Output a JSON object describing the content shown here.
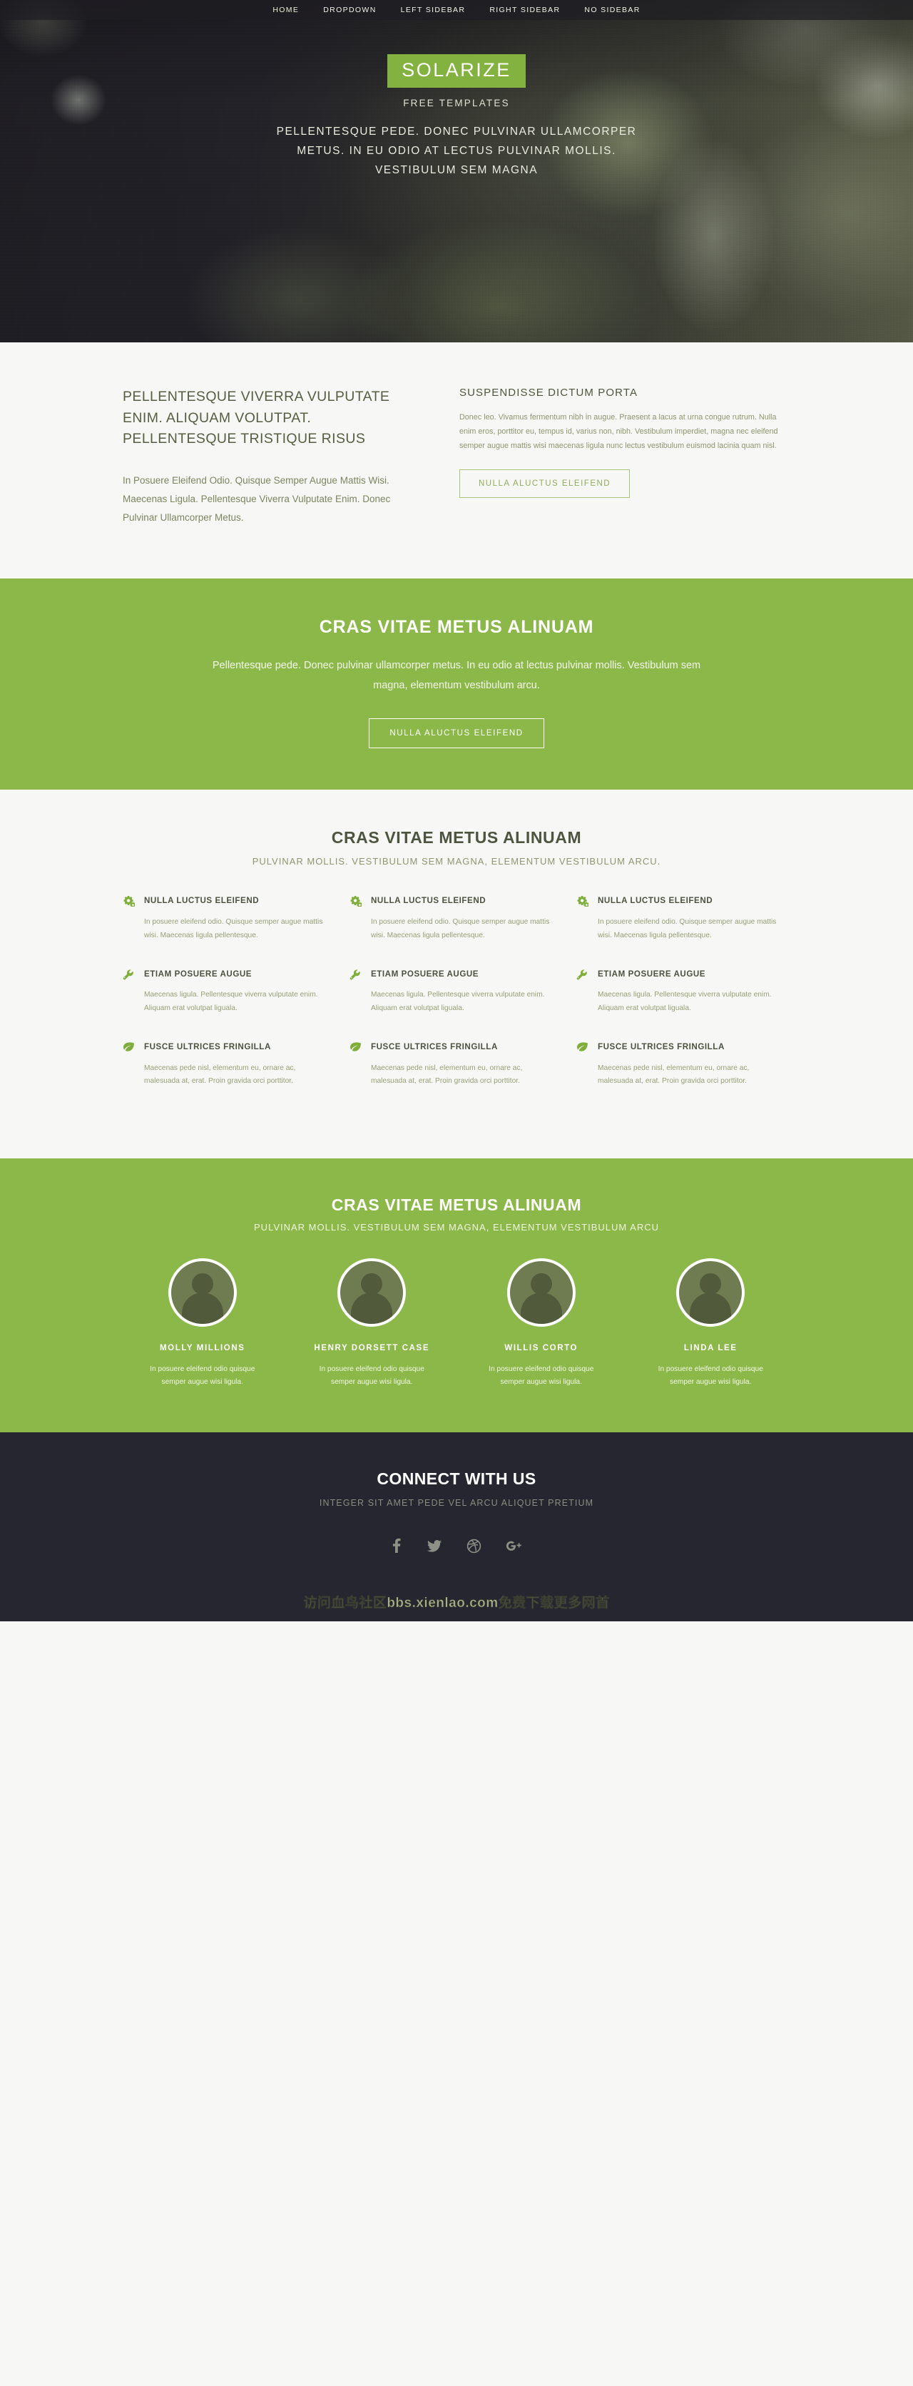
{
  "brand": {
    "accent_green": "#8cb84a",
    "dark": "#262630",
    "logo": "SOLARIZE"
  },
  "nav": {
    "items": [
      {
        "label": "HOME",
        "name": "nav-home"
      },
      {
        "label": "DROPDOWN",
        "name": "nav-dropdown"
      },
      {
        "label": "LEFT SIDEBAR",
        "name": "nav-left-sidebar"
      },
      {
        "label": "RIGHT SIDEBAR",
        "name": "nav-right-sidebar"
      },
      {
        "label": "NO SIDEBAR",
        "name": "nav-no-sidebar"
      }
    ]
  },
  "hero": {
    "logo": "SOLARIZE",
    "subtitle": "FREE TEMPLATES",
    "tagline_line1": "PELLENTESQUE PEDE. DONEC PULVINAR ULLAMCORPER",
    "tagline_line2": "METUS. IN EU ODIO AT LECTUS PULVINAR MOLLIS.",
    "tagline_line3": "VESTIBULUM SEM MAGNA"
  },
  "intro": {
    "left_heading": "PELLENTESQUE VIVERRA VULPUTATE ENIM. ALIQUAM VOLUTPAT. PELLENTESQUE TRISTIQUE RISUS",
    "left_body": "In Posuere Eleifend Odio. Quisque Semper Augue Mattis Wisi. Maecenas Ligula. Pellentesque Viverra Vulputate Enim. Donec Pulvinar Ullamcorper Metus.",
    "right_heading": "SUSPENDISSE DICTUM PORTA",
    "right_body": "Donec leo. Vivamus fermentum nibh in augue. Praesent a lacus at urna congue rutrum. Nulla enim eros, porttitor eu, tempus id, varius non, nibh. Vestibulum imperdiet, magna nec eleifend semper augue mattis wisi maecenas ligula nunc lectus vestibulum euismod lacinia quam nisl.",
    "button": "NULLA ALUCTUS ELEIFEND"
  },
  "cta": {
    "heading": "CRAS VITAE METUS ALINUAM",
    "body": "Pellentesque pede. Donec pulvinar ullamcorper metus. In eu odio at lectus pulvinar mollis. Vestibulum sem magna, elementum vestibulum arcu.",
    "button": "NULLA ALUCTUS ELEIFEND"
  },
  "features": {
    "heading": "CRAS VITAE METUS ALINUAM",
    "subheading": "PULVINAR MOLLIS. VESTIBULUM SEM MAGNA, ELEMENTUM VESTIBULUM ARCU.",
    "items": [
      {
        "icon": "gears-icon",
        "title": "NULLA LUCTUS ELEIFEND",
        "desc": "In posuere eleifend odio. Quisque semper augue mattis wisi. Maecenas ligula pellentesque."
      },
      {
        "icon": "gears-icon",
        "title": "NULLA LUCTUS ELEIFEND",
        "desc": "In posuere eleifend odio. Quisque semper augue mattis wisi. Maecenas ligula pellentesque."
      },
      {
        "icon": "gears-icon",
        "title": "NULLA LUCTUS ELEIFEND",
        "desc": "In posuere eleifend odio. Quisque semper augue mattis wisi. Maecenas ligula pellentesque."
      },
      {
        "icon": "wrench-icon",
        "title": "ETIAM POSUERE AUGUE",
        "desc": "Maecenas ligula. Pellentesque viverra vulputate enim. Aliquam erat volutpat liguala."
      },
      {
        "icon": "wrench-icon",
        "title": "ETIAM POSUERE AUGUE",
        "desc": "Maecenas ligula. Pellentesque viverra vulputate enim. Aliquam erat volutpat liguala."
      },
      {
        "icon": "wrench-icon",
        "title": "ETIAM POSUERE AUGUE",
        "desc": "Maecenas ligula. Pellentesque viverra vulputate enim. Aliquam erat volutpat liguala."
      },
      {
        "icon": "leaf-icon",
        "title": "FUSCE ULTRICES FRINGILLA",
        "desc": "Maecenas pede nisl, elementum eu, ornare ac, malesuada at, erat. Proin gravida orci porttitor."
      },
      {
        "icon": "leaf-icon",
        "title": "FUSCE ULTRICES FRINGILLA",
        "desc": "Maecenas pede nisl, elementum eu, ornare ac, malesuada at, erat. Proin gravida orci porttitor."
      },
      {
        "icon": "leaf-icon",
        "title": "FUSCE ULTRICES FRINGILLA",
        "desc": "Maecenas pede nisl, elementum eu, ornare ac, malesuada at, erat. Proin gravida orci porttitor."
      }
    ]
  },
  "team": {
    "heading": "CRAS VITAE METUS ALINUAM",
    "subheading": "PULVINAR MOLLIS. VESTIBULUM SEM MAGNA, ELEMENTUM VESTIBULUM ARCU",
    "members": [
      {
        "name": "MOLLY MILLIONS",
        "desc": "In posuere eleifend odio quisque semper augue wisi ligula."
      },
      {
        "name": "HENRY DORSETT CASE",
        "desc": "In posuere eleifend odio quisque semper augue wisi ligula."
      },
      {
        "name": "WILLIS CORTO",
        "desc": "In posuere eleifend odio quisque semper augue wisi ligula."
      },
      {
        "name": "LINDA LEE",
        "desc": "In posuere eleifend odio quisque semper augue wisi ligula."
      }
    ]
  },
  "footer": {
    "heading": "CONNECT WITH US",
    "subheading": "INTEGER SIT AMET PEDE VEL ARCU ALIQUET PRETIUM",
    "socials": [
      {
        "icon": "facebook-icon",
        "label": "Facebook"
      },
      {
        "icon": "twitter-icon",
        "label": "Twitter"
      },
      {
        "icon": "dribbble-icon",
        "label": "Dribbble"
      },
      {
        "icon": "google-plus-icon",
        "label": "Google Plus"
      }
    ]
  },
  "watermark": {
    "text": "访问血鸟社区bbs.xienlao.com免费下载更多网首"
  }
}
